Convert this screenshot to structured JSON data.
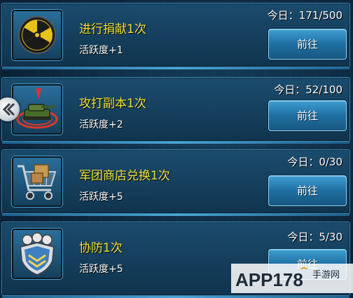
{
  "tasks": [
    {
      "icon": "radiation-icon",
      "title": "进行捐献1次",
      "reward": "活跃度+1",
      "progress": "今日：171/500",
      "button_label": "前往"
    },
    {
      "icon": "tank-icon",
      "title": "攻打副本1次",
      "reward": "活跃度+2",
      "progress": "今日：52/100",
      "button_label": "前往"
    },
    {
      "icon": "shopping-cart-icon",
      "title": "军团商店兑换1次",
      "reward": "活跃度+5",
      "progress": "今日：0/30",
      "button_label": "前往"
    },
    {
      "icon": "shield-icon",
      "title": "协防1次",
      "reward": "活跃度+5",
      "progress": "今日：5/30",
      "button_label": "前往"
    }
  ],
  "watermark": {
    "text": "APP178",
    "subtext": "手游网"
  },
  "colors": {
    "title": "#f2e63a",
    "panel_border": "#3b86b3",
    "button": "#2a84ba"
  }
}
